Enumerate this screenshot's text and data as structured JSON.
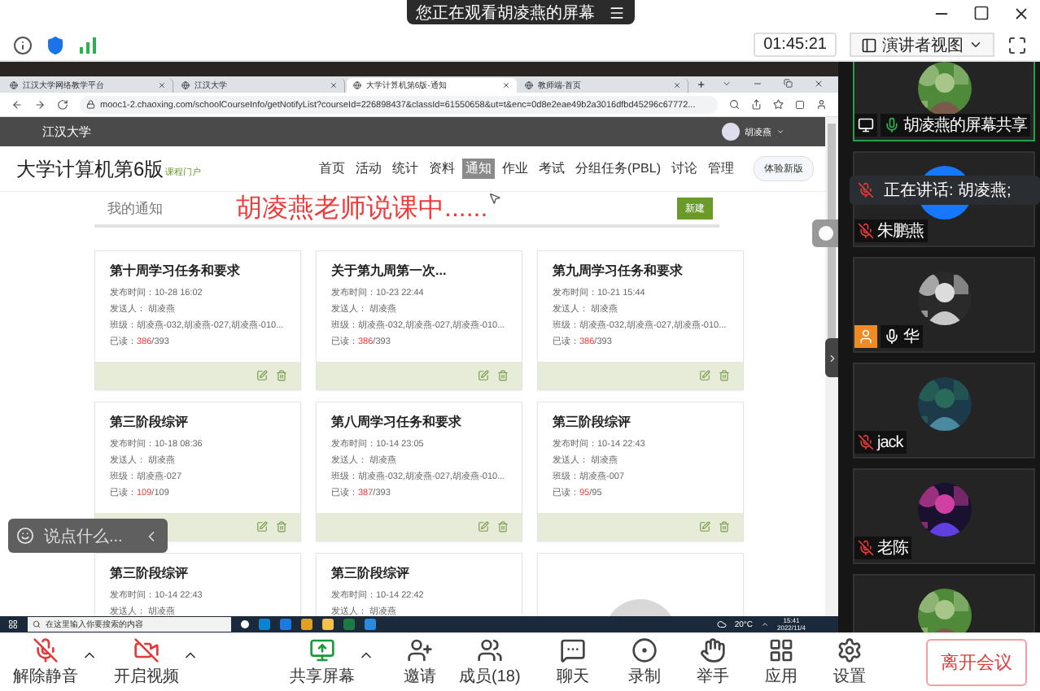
{
  "banner": {
    "text": "您正在观看胡凌燕的屏幕"
  },
  "toolbar": {
    "timer": "01:45:21",
    "view_menu": "演讲者视图"
  },
  "shared_screen": {
    "browser_tabs": [
      {
        "label": "江汉大学网络教学平台",
        "selected": false
      },
      {
        "label": "江汉大学",
        "selected": false
      },
      {
        "label": "大学计算机第6版-通知",
        "selected": true
      },
      {
        "label": "教师端-首页",
        "selected": false
      }
    ],
    "address": "mooc1-2.chaoxing.com/schoolCourseInfo/getNotifyList?courseId=226898437&classId=61550658&ut=t&enc=0d8e2eae49b2a3016dfbd45296c67772...",
    "site_header": {
      "school": "江汉大学",
      "user": "胡凌燕"
    },
    "course": {
      "title": "大学计算机第6版",
      "portal": "课程门户"
    },
    "nav": [
      {
        "label": "首页",
        "selected": false
      },
      {
        "label": "活动",
        "selected": false
      },
      {
        "label": "统计",
        "selected": false
      },
      {
        "label": "资料",
        "selected": false
      },
      {
        "label": "通知",
        "selected": true
      },
      {
        "label": "作业",
        "selected": false
      },
      {
        "label": "考试",
        "selected": false
      },
      {
        "label": "分组任务(PBL)",
        "selected": false
      },
      {
        "label": "讨论",
        "selected": false
      },
      {
        "label": "管理",
        "selected": false
      }
    ],
    "try_new": "体验新版",
    "section": "我的通知",
    "presenting": "胡凌燕老师说课中......",
    "new_button": "新建",
    "cards": [
      {
        "kind": "notice",
        "title": "第十周学习任务和要求",
        "time": "发布时间：10-28 16:02",
        "sender": "发送人：  胡凌燕",
        "classes": "班级：胡凌燕-032,胡凌燕-027,胡凌燕-010...",
        "read_label": "已读：",
        "read": "386",
        "total": "/393"
      },
      {
        "kind": "notice",
        "title": "关于第九周第一次...",
        "time": "发布时间：10-23 22:44",
        "sender": "发送人：  胡凌燕",
        "classes": "班级：胡凌燕-032,胡凌燕-027,胡凌燕-010...",
        "read_label": "已读：",
        "read": "386",
        "total": "/393"
      },
      {
        "kind": "notice",
        "title": "第九周学习任务和要求",
        "time": "发布时间：10-21 15:44",
        "sender": "发送人：  胡凌燕",
        "classes": "班级：胡凌燕-032,胡凌燕-027,胡凌燕-010...",
        "read_label": "已读：",
        "read": "386",
        "total": "/393"
      },
      {
        "kind": "notice",
        "title": "第三阶段综评",
        "time": "发布时间：10-18 08:36",
        "sender": "发送人：  胡凌燕",
        "classes": "班级：胡凌燕-027",
        "read_label": "已读：",
        "read": "109",
        "total": "/109"
      },
      {
        "kind": "notice",
        "title": "第八周学习任务和要求",
        "time": "发布时间：10-14 23:05",
        "sender": "发送人：  胡凌燕",
        "classes": "班级：胡凌燕-032,胡凌燕-027,胡凌燕-010...",
        "read_label": "已读：",
        "read": "387",
        "total": "/393"
      },
      {
        "kind": "notice",
        "title": "第三阶段综评",
        "time": "发布时间：10-14 22:43",
        "sender": "发送人：  胡凌燕",
        "classes": "班级：胡凌燕-007",
        "read_label": "已读：",
        "read": "95",
        "total": "/95"
      },
      {
        "kind": "notice",
        "title": "第三阶段综评",
        "time": "发布时间：10-14 22:43",
        "sender": "发送人：  胡凌燕"
      },
      {
        "kind": "notice",
        "title": "第三阶段综评",
        "time": "发布时间：10-14 22:42",
        "sender": "发送人：  胡凌燕"
      },
      {
        "kind": "loading"
      }
    ],
    "chat_placeholder": "说点什么...",
    "taskbar": {
      "search_placeholder": "在这里输入你要搜索的内容",
      "weather": "20°C",
      "time": "15:41",
      "date": "2022/11/4"
    }
  },
  "participants": [
    {
      "name": "胡凌燕的屏幕共享",
      "kind": "picture",
      "muted": false,
      "sharing": true,
      "host": false,
      "active": true
    },
    {
      "name": "朱鹏燕",
      "kind": "plain",
      "muted": true,
      "sharing": false,
      "host": false,
      "active": false
    },
    {
      "name": "华",
      "kind": "picture",
      "muted": false,
      "sharing": false,
      "host": true,
      "active": false
    },
    {
      "name": "jack",
      "kind": "picture",
      "muted": true,
      "sharing": false,
      "host": false,
      "active": false
    },
    {
      "name": "老陈",
      "kind": "picture",
      "muted": true,
      "sharing": false,
      "host": false,
      "active": false
    },
    {
      "kind": "picture",
      "active": false
    }
  ],
  "speaking": "正在讲话: 胡凌燕;",
  "controls": [
    {
      "label": "解除静音",
      "kind": "mic"
    },
    {
      "label": "开启视频",
      "kind": "video"
    },
    {
      "label": "共享屏幕",
      "kind": "share"
    },
    {
      "label": "邀请",
      "kind": "invite"
    },
    {
      "label": "成员(18)",
      "kind": "members"
    },
    {
      "label": "聊天",
      "kind": "chat"
    },
    {
      "label": "录制",
      "kind": "record"
    },
    {
      "label": "举手",
      "kind": "raise"
    },
    {
      "label": "应用",
      "kind": "apps"
    },
    {
      "label": "设置",
      "kind": "settings"
    }
  ],
  "leave": "离开会议"
}
